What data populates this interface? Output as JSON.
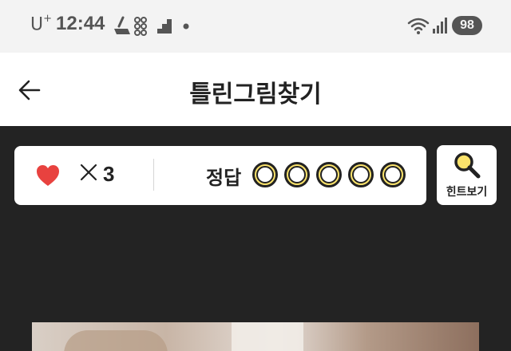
{
  "status_bar": {
    "carrier": "U",
    "carrier_plus": "+",
    "time": "12:44",
    "battery": "98",
    "icons": [
      "cleaner-icon",
      "grid-app-icon",
      "stairs-icon",
      "dot-icon",
      "wifi-icon",
      "signal-icon"
    ]
  },
  "header": {
    "back_icon": "arrow-left-icon",
    "title": "틀린그림찾기"
  },
  "game_status": {
    "lives_icon": "heart-icon",
    "lives_count": "3",
    "answer_label": "정답",
    "answers_found": 0,
    "answers_total": 5
  },
  "hint": {
    "label": "힌트보기",
    "icon": "magnifier-icon"
  },
  "colors": {
    "background": "#232323",
    "accent_yellow": "#fbe36b",
    "heart_red": "#e8423f"
  }
}
